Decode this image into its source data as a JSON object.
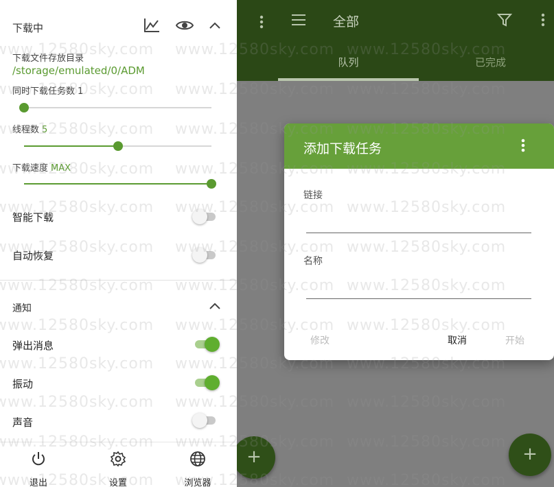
{
  "left_panel": {
    "download_section": {
      "title": "下载中",
      "icons": [
        "chart-icon",
        "eye-icon",
        "chevron-up-icon"
      ]
    },
    "dir_label": "下载文件存放目录",
    "dir_path": "/storage/emulated/0/ADM",
    "concurrent": {
      "label": "同时下载任务数",
      "value": "1",
      "level": 0.0
    },
    "threads": {
      "label": "线程数",
      "value": "5",
      "level": 0.5
    },
    "speed": {
      "label": "下载速度",
      "value": "MAX",
      "level": 1.0
    },
    "toggles": [
      {
        "label": "智能下载",
        "on": false
      },
      {
        "label": "自动恢复",
        "on": false
      }
    ],
    "notify_section": {
      "title": "通知"
    },
    "notify_toggles": [
      {
        "label": "弹出消息",
        "on": true
      },
      {
        "label": "振动",
        "on": true
      },
      {
        "label": "声音",
        "on": false
      }
    ],
    "bottom_nav": [
      {
        "label": "退出",
        "icon": "power-icon"
      },
      {
        "label": "设置",
        "icon": "gear-icon"
      },
      {
        "label": "浏览器",
        "icon": "globe-icon"
      }
    ]
  },
  "app": {
    "title": "全部",
    "tabs": [
      {
        "label": "队列",
        "active": true
      },
      {
        "label": "已完成",
        "active": false
      }
    ],
    "fab_label": "+"
  },
  "dialog": {
    "title": "添加下载任务",
    "link_label": "链接",
    "link_value": "",
    "name_label": "名称",
    "name_value": "",
    "buttons": {
      "edit": "修改",
      "cancel": "取消",
      "start": "开始"
    }
  },
  "watermark": "www.12580sky.com",
  "colors": {
    "accent": "#5a9a30",
    "appbar": "#2b4816",
    "dialog_header": "#67a03a",
    "scrim": "#7f7f7f"
  }
}
